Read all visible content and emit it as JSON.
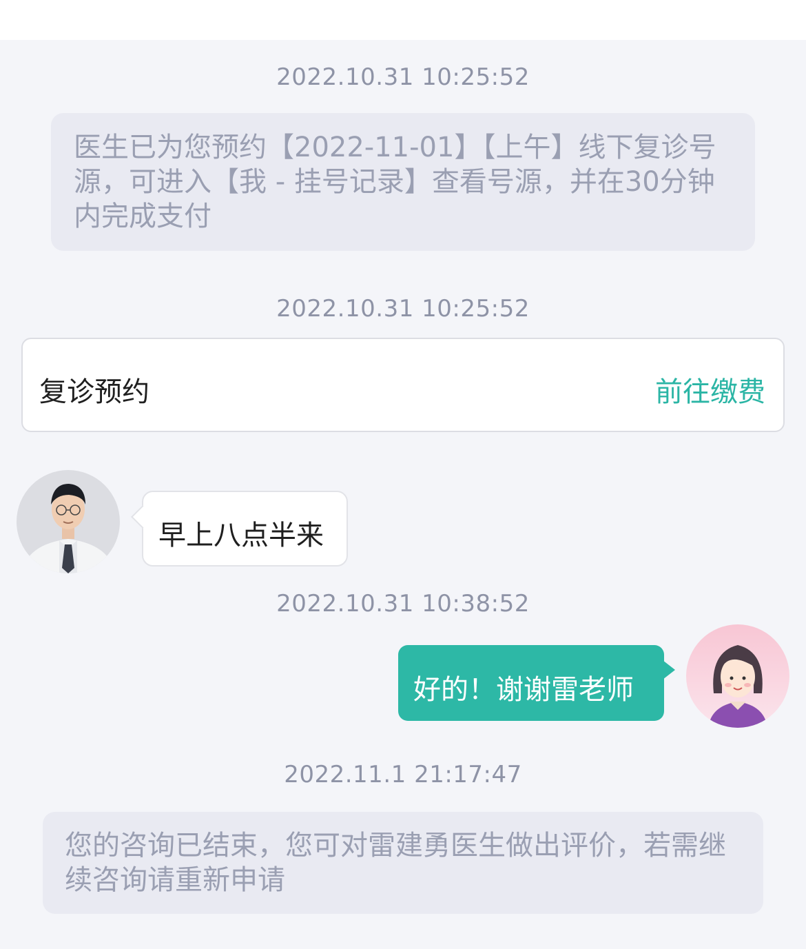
{
  "messages": {
    "ts1": "2022.10.31 10:25:52",
    "system1": "医生已为您预约【2022-11-01】【上午】线下复诊号源，可进入【我 - 挂号记录】查看号源，并在30分钟内完成支付",
    "ts2": "2022.10.31 10:25:52",
    "card_title": "复诊预约",
    "card_action": "前往缴费",
    "doctor_msg": "早上八点半来",
    "ts3": "2022.10.31 10:38:52",
    "patient_msg": "好的！谢谢雷老师",
    "ts4": "2022.11.1 21:17:47",
    "system2": "您的咨询已结束，您可对雷建勇医生做出评价，若需继续咨询请重新申请"
  },
  "colors": {
    "accent": "#2bb5a5",
    "patient_bubble": "#2db8a6",
    "system_bg": "#e9eaf2",
    "page_bg": "#f4f5f9"
  },
  "icons": {
    "doctor_avatar": "doctor-avatar",
    "patient_avatar": "patient-avatar"
  }
}
